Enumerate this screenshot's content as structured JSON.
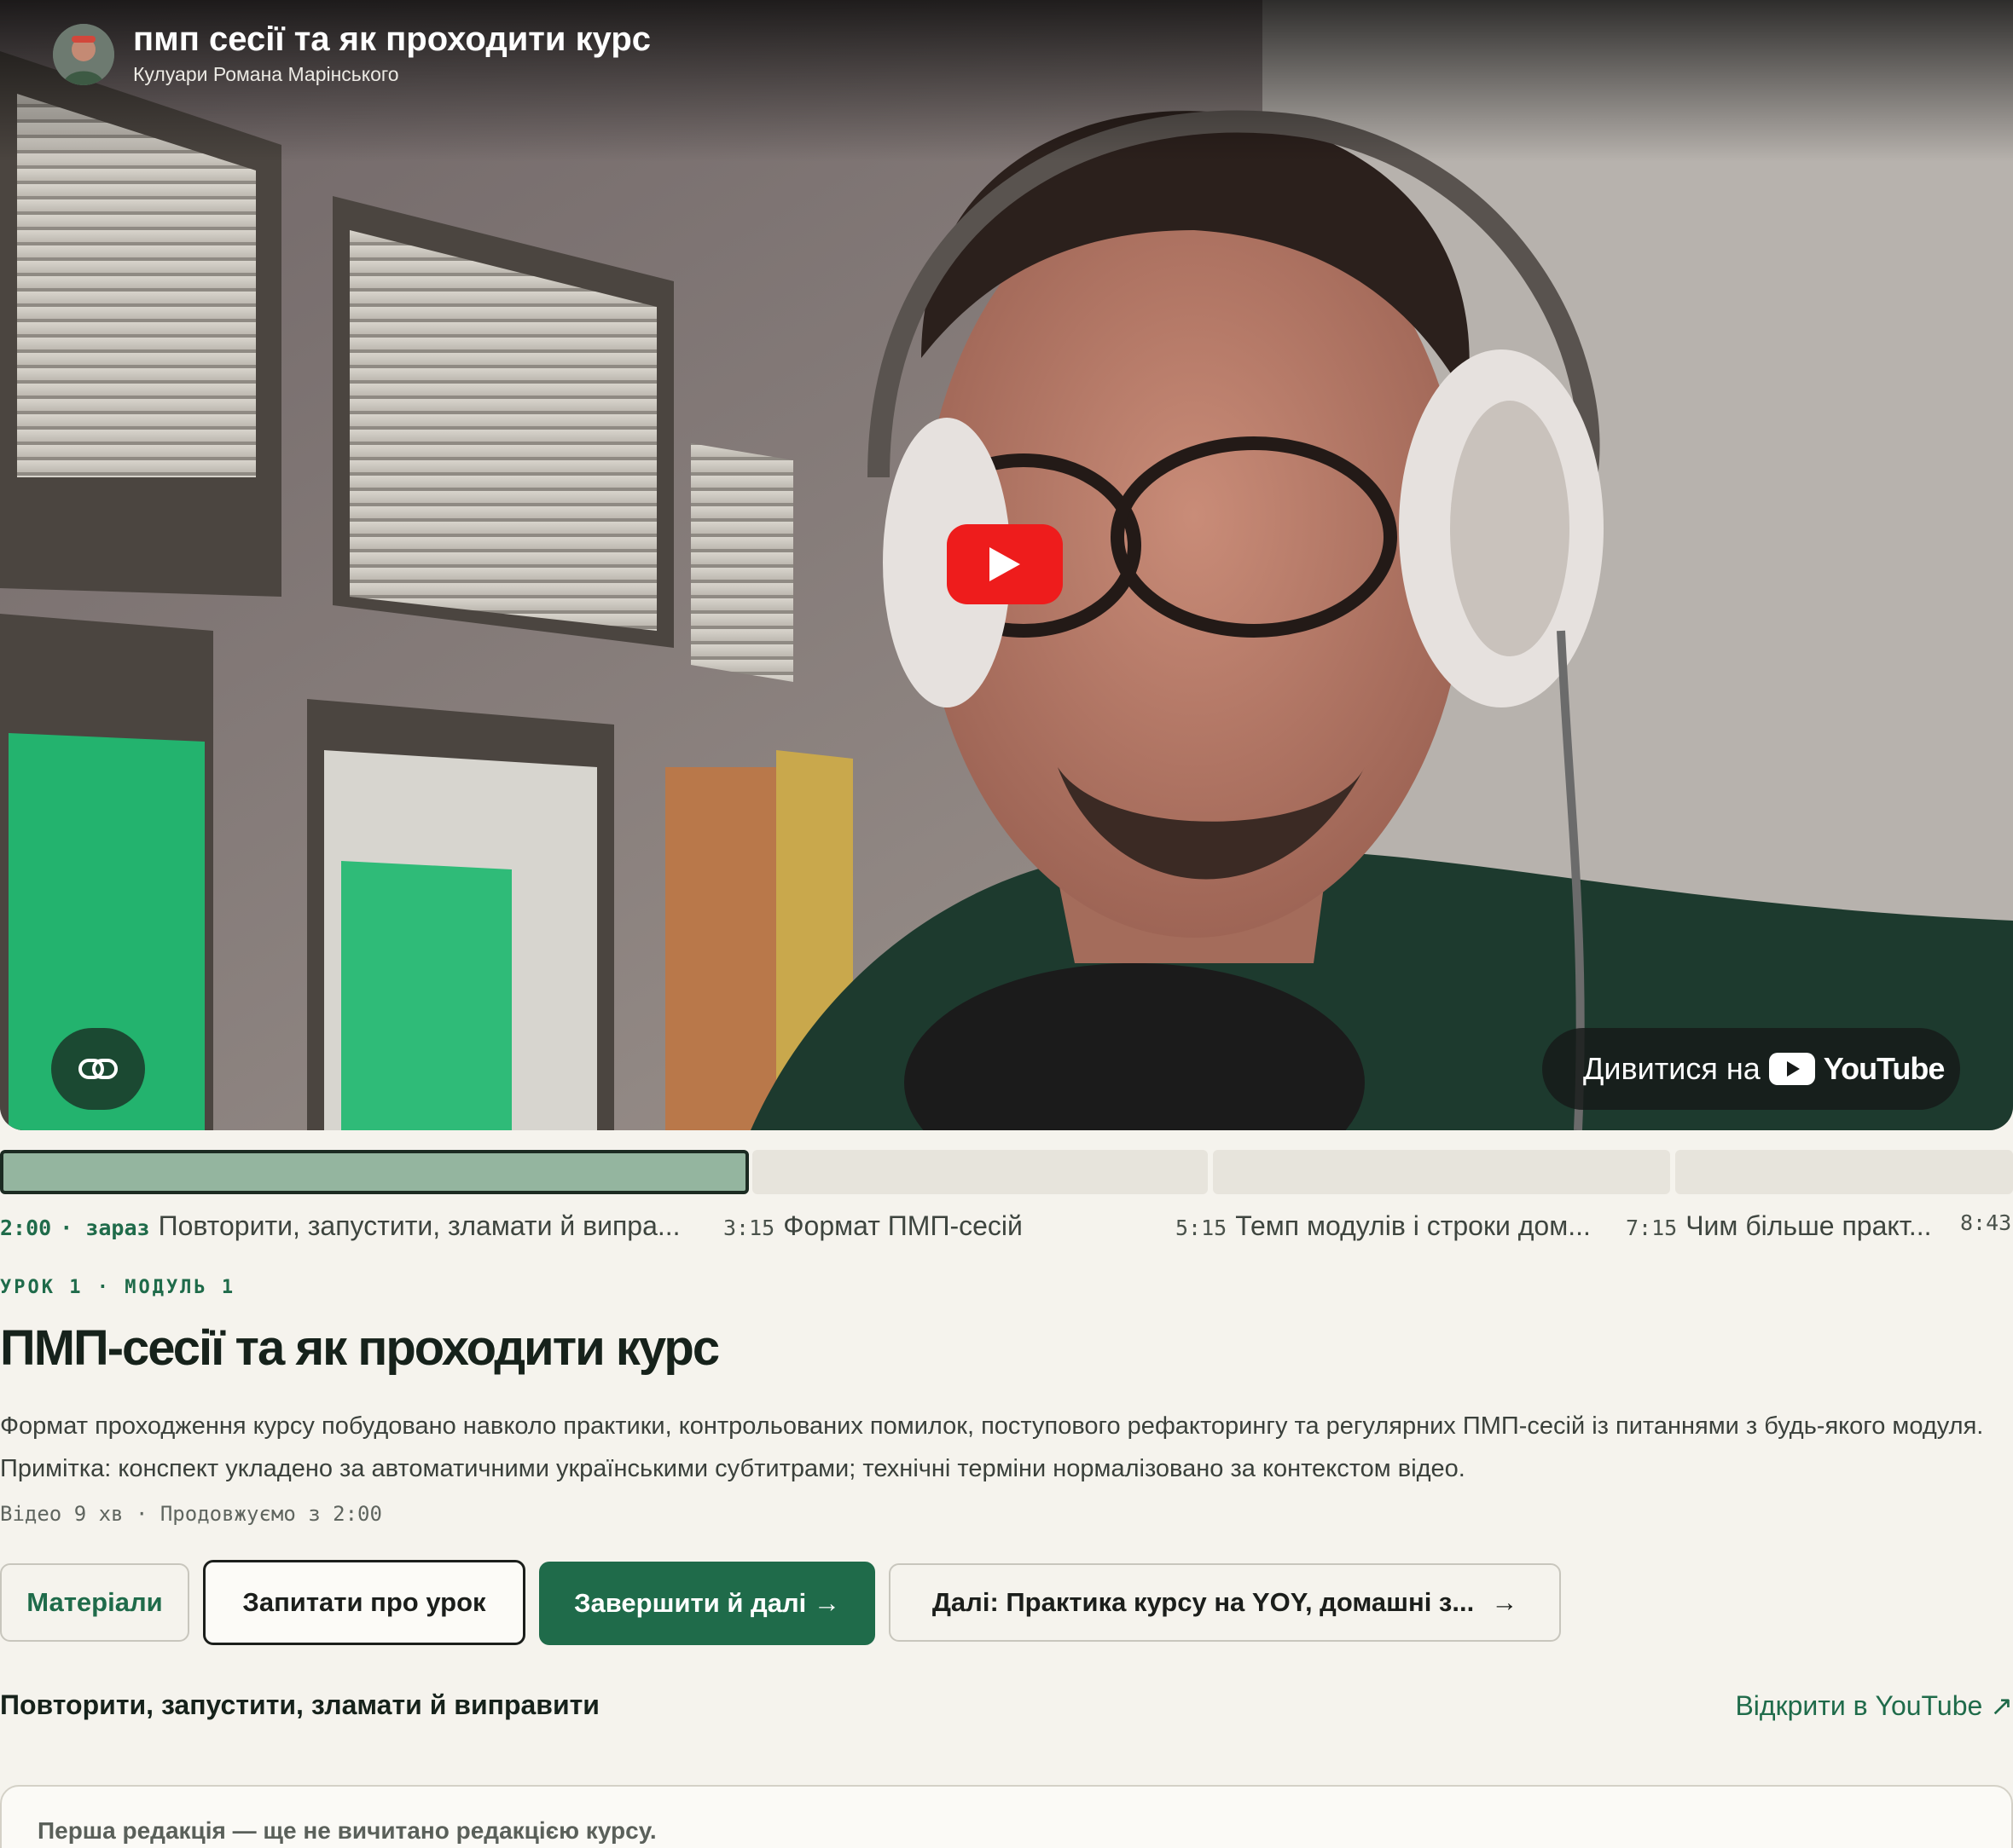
{
  "player": {
    "video_title": "пмп сесії та як проходити курс",
    "channel_name": "Кулуари Романа Марінського",
    "watch_on_label": "Дивитися на",
    "youtube_wordmark": "YouTube",
    "play_icon": "play-icon",
    "link_icon": "link-icon",
    "accent_color": "#ee1c1c"
  },
  "timeline": {
    "progress_color": "#94b59f",
    "chapters": [
      {
        "time": "2:00",
        "now_label": "· зараз",
        "title": "Повторити, запустити, зламати й випра..."
      },
      {
        "time": "3:15",
        "title": "Формат ПМП-сесій"
      },
      {
        "time": "5:15",
        "title": "Темп модулів і строки дом..."
      },
      {
        "time": "7:15",
        "title": "Чим більше практ..."
      },
      {
        "time": "8:43",
        "title": ""
      }
    ]
  },
  "lesson": {
    "eyebrow": "УРОК 1 · МОДУЛЬ 1",
    "title": "ПМП-сесії та як проходити курс",
    "description": "Формат проходження курсу побудовано навколо практики, контрольованих помилок, поступового рефакторингу та регулярних ПМП-сесій із питаннями з будь-якого модуля. Примітка: конспект укладено за автоматичними українськими субтитрами; технічні терміни нормалізовано за контекстом відео.",
    "meta": "Відео 9 хв · Продовжуємо з 2:00"
  },
  "actions": {
    "materials": "Матеріали",
    "ask": "Запитати про урок",
    "complete": "Завершити й далі →",
    "next": "Далі: Практика курсу на YOY, домашні з...",
    "next_arrow": "→",
    "brand_color": "#1f6b4a"
  },
  "chapter_section": {
    "heading": "Повторити, запустити, зламати й виправити",
    "open_youtube": "Відкрити в YouTube ↗"
  },
  "notice": {
    "text": "Перша редакція — ще не вичитано редакцією курсу."
  }
}
